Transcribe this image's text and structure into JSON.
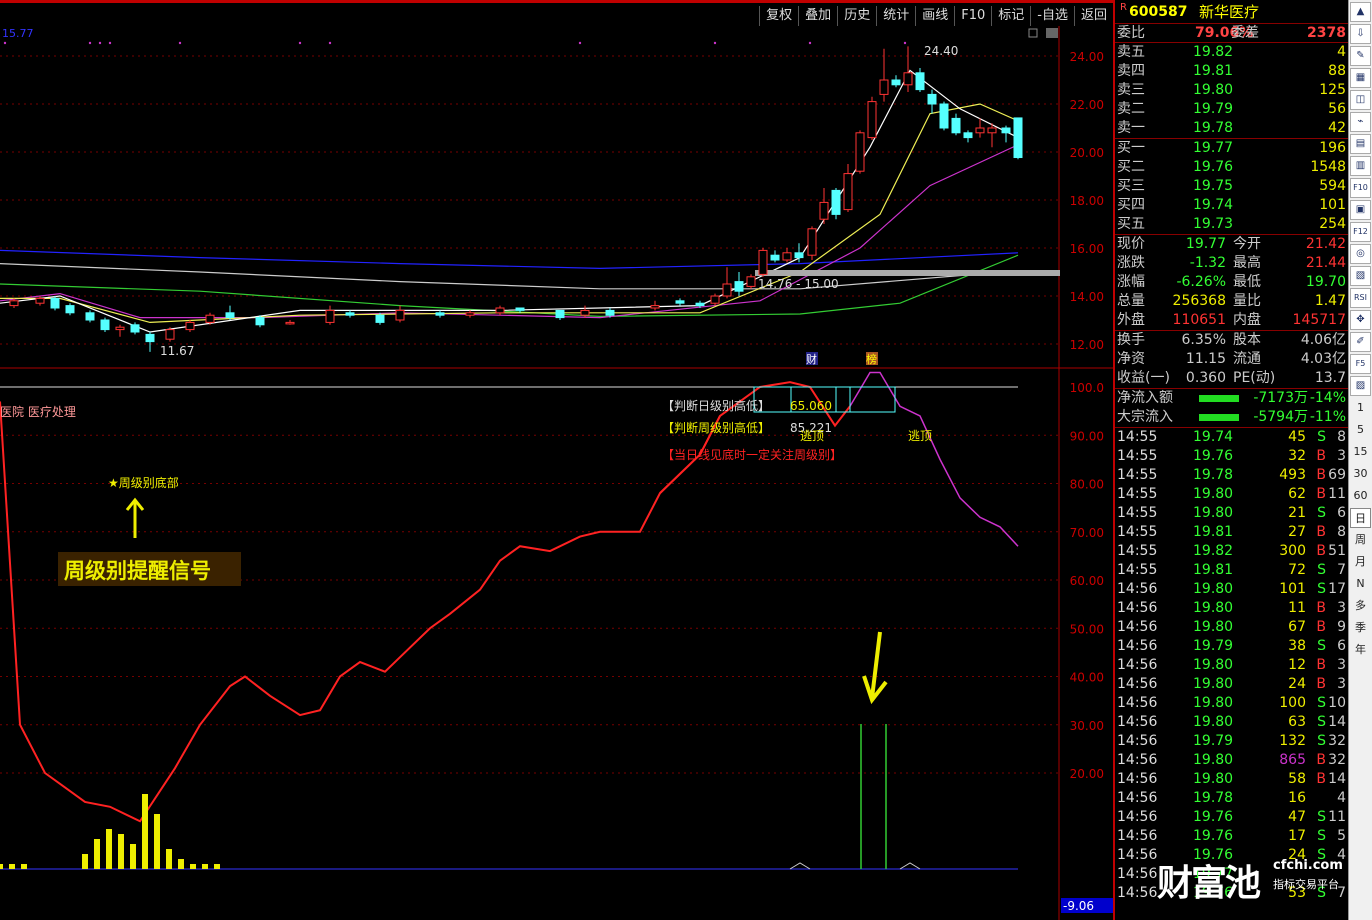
{
  "toolbar": [
    "复权",
    "叠加",
    "历史",
    "统计",
    "画线",
    "F10",
    "标记",
    "-自选",
    "返回"
  ],
  "chart": {
    "ma_label": "15.77",
    "top_price_label": "24.40",
    "low_price_label": "11.67",
    "range_label": "14.76 - 15.00",
    "markers": [
      "财",
      "榜"
    ],
    "price_ticks": [
      "24.00",
      "22.00",
      "20.00",
      "18.00",
      "16.00",
      "14.00",
      "12.00"
    ],
    "ind_ticks": [
      "100.0",
      "90.00",
      "80.00",
      "70.00",
      "60.00",
      "50.00",
      "40.00",
      "30.00",
      "20.00"
    ],
    "bottom_value": "-9.06",
    "indicator_title": "医院 医疗处理",
    "box_line1_label": "【判断日级别高低】",
    "box_line1_value": "65.060",
    "box_line2_label": "【判断周级别高低】",
    "box_line2_value": "85.221",
    "box_line3": "【当日线见底时一定关注周级别】",
    "escape1": "逃顶",
    "escape2": "逃顶",
    "weekly_bottom": "★周级别底部",
    "weekly_signal": "周级别提醒信号"
  },
  "quote": {
    "flag": "R",
    "code": "600587",
    "name": "新华医疗",
    "webi_label": "委比",
    "webi": "79.06%",
    "weicha_label": "委差",
    "weicha": "2378",
    "asks": [
      [
        "卖五",
        "19.82",
        "4"
      ],
      [
        "卖四",
        "19.81",
        "88"
      ],
      [
        "卖三",
        "19.80",
        "125"
      ],
      [
        "卖二",
        "19.79",
        "56"
      ],
      [
        "卖一",
        "19.78",
        "42"
      ]
    ],
    "bids": [
      [
        "买一",
        "19.77",
        "196"
      ],
      [
        "买二",
        "19.76",
        "1548"
      ],
      [
        "买三",
        "19.75",
        "594"
      ],
      [
        "买四",
        "19.74",
        "101"
      ],
      [
        "买五",
        "19.73",
        "254"
      ]
    ],
    "stats": [
      [
        "现价",
        "19.77",
        "今开",
        "21.42"
      ],
      [
        "涨跌",
        "-1.32",
        "最高",
        "21.44"
      ],
      [
        "涨幅",
        "-6.26%",
        "最低",
        "19.70"
      ],
      [
        "总量",
        "256368",
        "量比",
        "1.47"
      ],
      [
        "外盘",
        "110651",
        "内盘",
        "145717"
      ]
    ],
    "stats2": [
      [
        "换手",
        "6.35%",
        "股本",
        "4.06亿"
      ],
      [
        "净资",
        "11.15",
        "流通",
        "4.03亿"
      ],
      [
        "收益(一)",
        "0.360",
        "PE(动)",
        "13.7"
      ]
    ],
    "flow": [
      [
        "净流入额",
        "-7173万",
        "-14%"
      ],
      [
        "大宗流入",
        "-5794万",
        "-11%"
      ]
    ],
    "ticks": [
      [
        "14:55",
        "19.74",
        "45",
        "S",
        "8"
      ],
      [
        "14:55",
        "19.76",
        "32",
        "B",
        "3"
      ],
      [
        "14:55",
        "19.78",
        "493",
        "B",
        "69"
      ],
      [
        "14:55",
        "19.80",
        "62",
        "B",
        "11"
      ],
      [
        "14:55",
        "19.80",
        "21",
        "S",
        "6"
      ],
      [
        "14:55",
        "19.81",
        "27",
        "B",
        "8"
      ],
      [
        "14:55",
        "19.82",
        "300",
        "B",
        "51"
      ],
      [
        "14:55",
        "19.81",
        "72",
        "S",
        "7"
      ],
      [
        "14:56",
        "19.80",
        "101",
        "S",
        "17"
      ],
      [
        "14:56",
        "19.80",
        "11",
        "B",
        "3"
      ],
      [
        "14:56",
        "19.80",
        "67",
        "B",
        "9"
      ],
      [
        "14:56",
        "19.79",
        "38",
        "S",
        "6"
      ],
      [
        "14:56",
        "19.80",
        "12",
        "B",
        "3"
      ],
      [
        "14:56",
        "19.80",
        "24",
        "B",
        "3"
      ],
      [
        "14:56",
        "19.80",
        "100",
        "S",
        "10"
      ],
      [
        "14:56",
        "19.80",
        "63",
        "S",
        "14"
      ],
      [
        "14:56",
        "19.79",
        "132",
        "S",
        "32"
      ],
      [
        "14:56",
        "19.80",
        "865",
        "B",
        "32"
      ],
      [
        "14:56",
        "19.80",
        "58",
        "B",
        "14"
      ],
      [
        "14:56",
        "19.78",
        "16",
        "",
        "4"
      ],
      [
        "14:56",
        "19.76",
        "47",
        "S",
        "11"
      ],
      [
        "14:56",
        "19.76",
        "17",
        "S",
        "5"
      ],
      [
        "14:56",
        "19.76",
        "24",
        "S",
        "4"
      ],
      [
        "14:56",
        "19.77",
        "",
        "",
        ""
      ],
      [
        "14:56",
        "19.76",
        "53",
        "S",
        "7"
      ]
    ]
  },
  "sidebar": [
    "1",
    "5",
    "15",
    "30",
    "60",
    "日",
    "周",
    "月",
    "N",
    "多",
    "季",
    "年"
  ],
  "watermark": {
    "brand": "财富池",
    "site": "cfchi.com",
    "slogan": "指标交易平台"
  }
}
